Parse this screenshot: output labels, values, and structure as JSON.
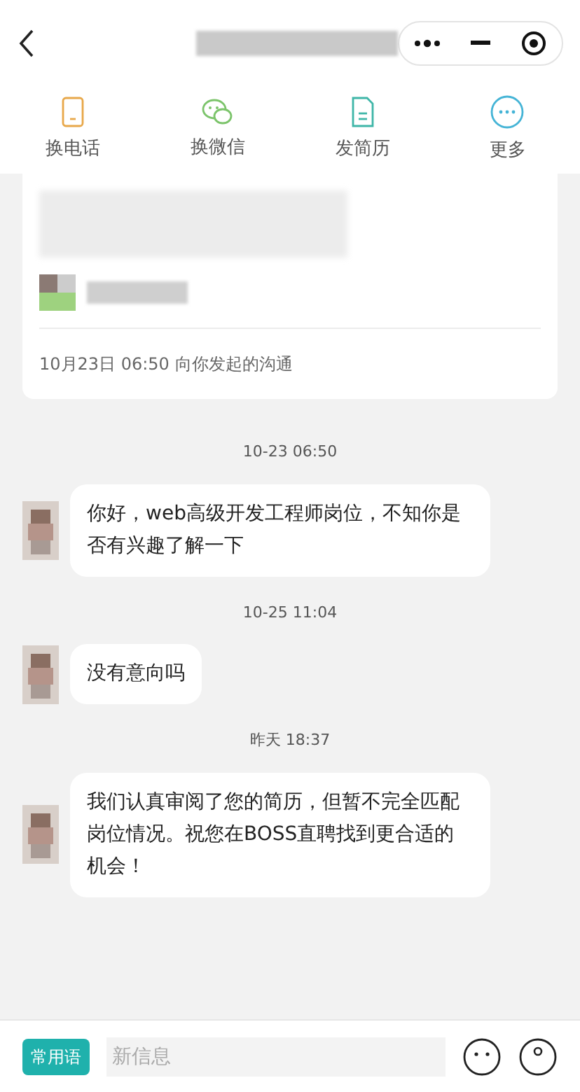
{
  "actions": [
    {
      "kind": "phone",
      "label": "换电话"
    },
    {
      "kind": "wechat",
      "label": "换微信"
    },
    {
      "kind": "resume",
      "label": "发简历"
    },
    {
      "kind": "more",
      "label": "更多"
    }
  ],
  "card": {
    "footer": "10月23日 06:50 向你发起的沟通"
  },
  "messages": [
    {
      "kind": "time",
      "text": "10-23 06:50"
    },
    {
      "kind": "bubble",
      "text": "你好，web高级开发工程师岗位，不知你是否有兴趣了解一下"
    },
    {
      "kind": "time",
      "text": "10-25 11:04"
    },
    {
      "kind": "bubble",
      "text": "没有意向吗"
    },
    {
      "kind": "time",
      "text": "昨天 18:37"
    },
    {
      "kind": "bubble",
      "text": "我们认真审阅了您的简历，但暂不完全匹配岗位情况。祝您在BOSS直聘找到更合适的机会！"
    }
  ],
  "input": {
    "phrases": "常用语",
    "placeholder": "新信息"
  }
}
